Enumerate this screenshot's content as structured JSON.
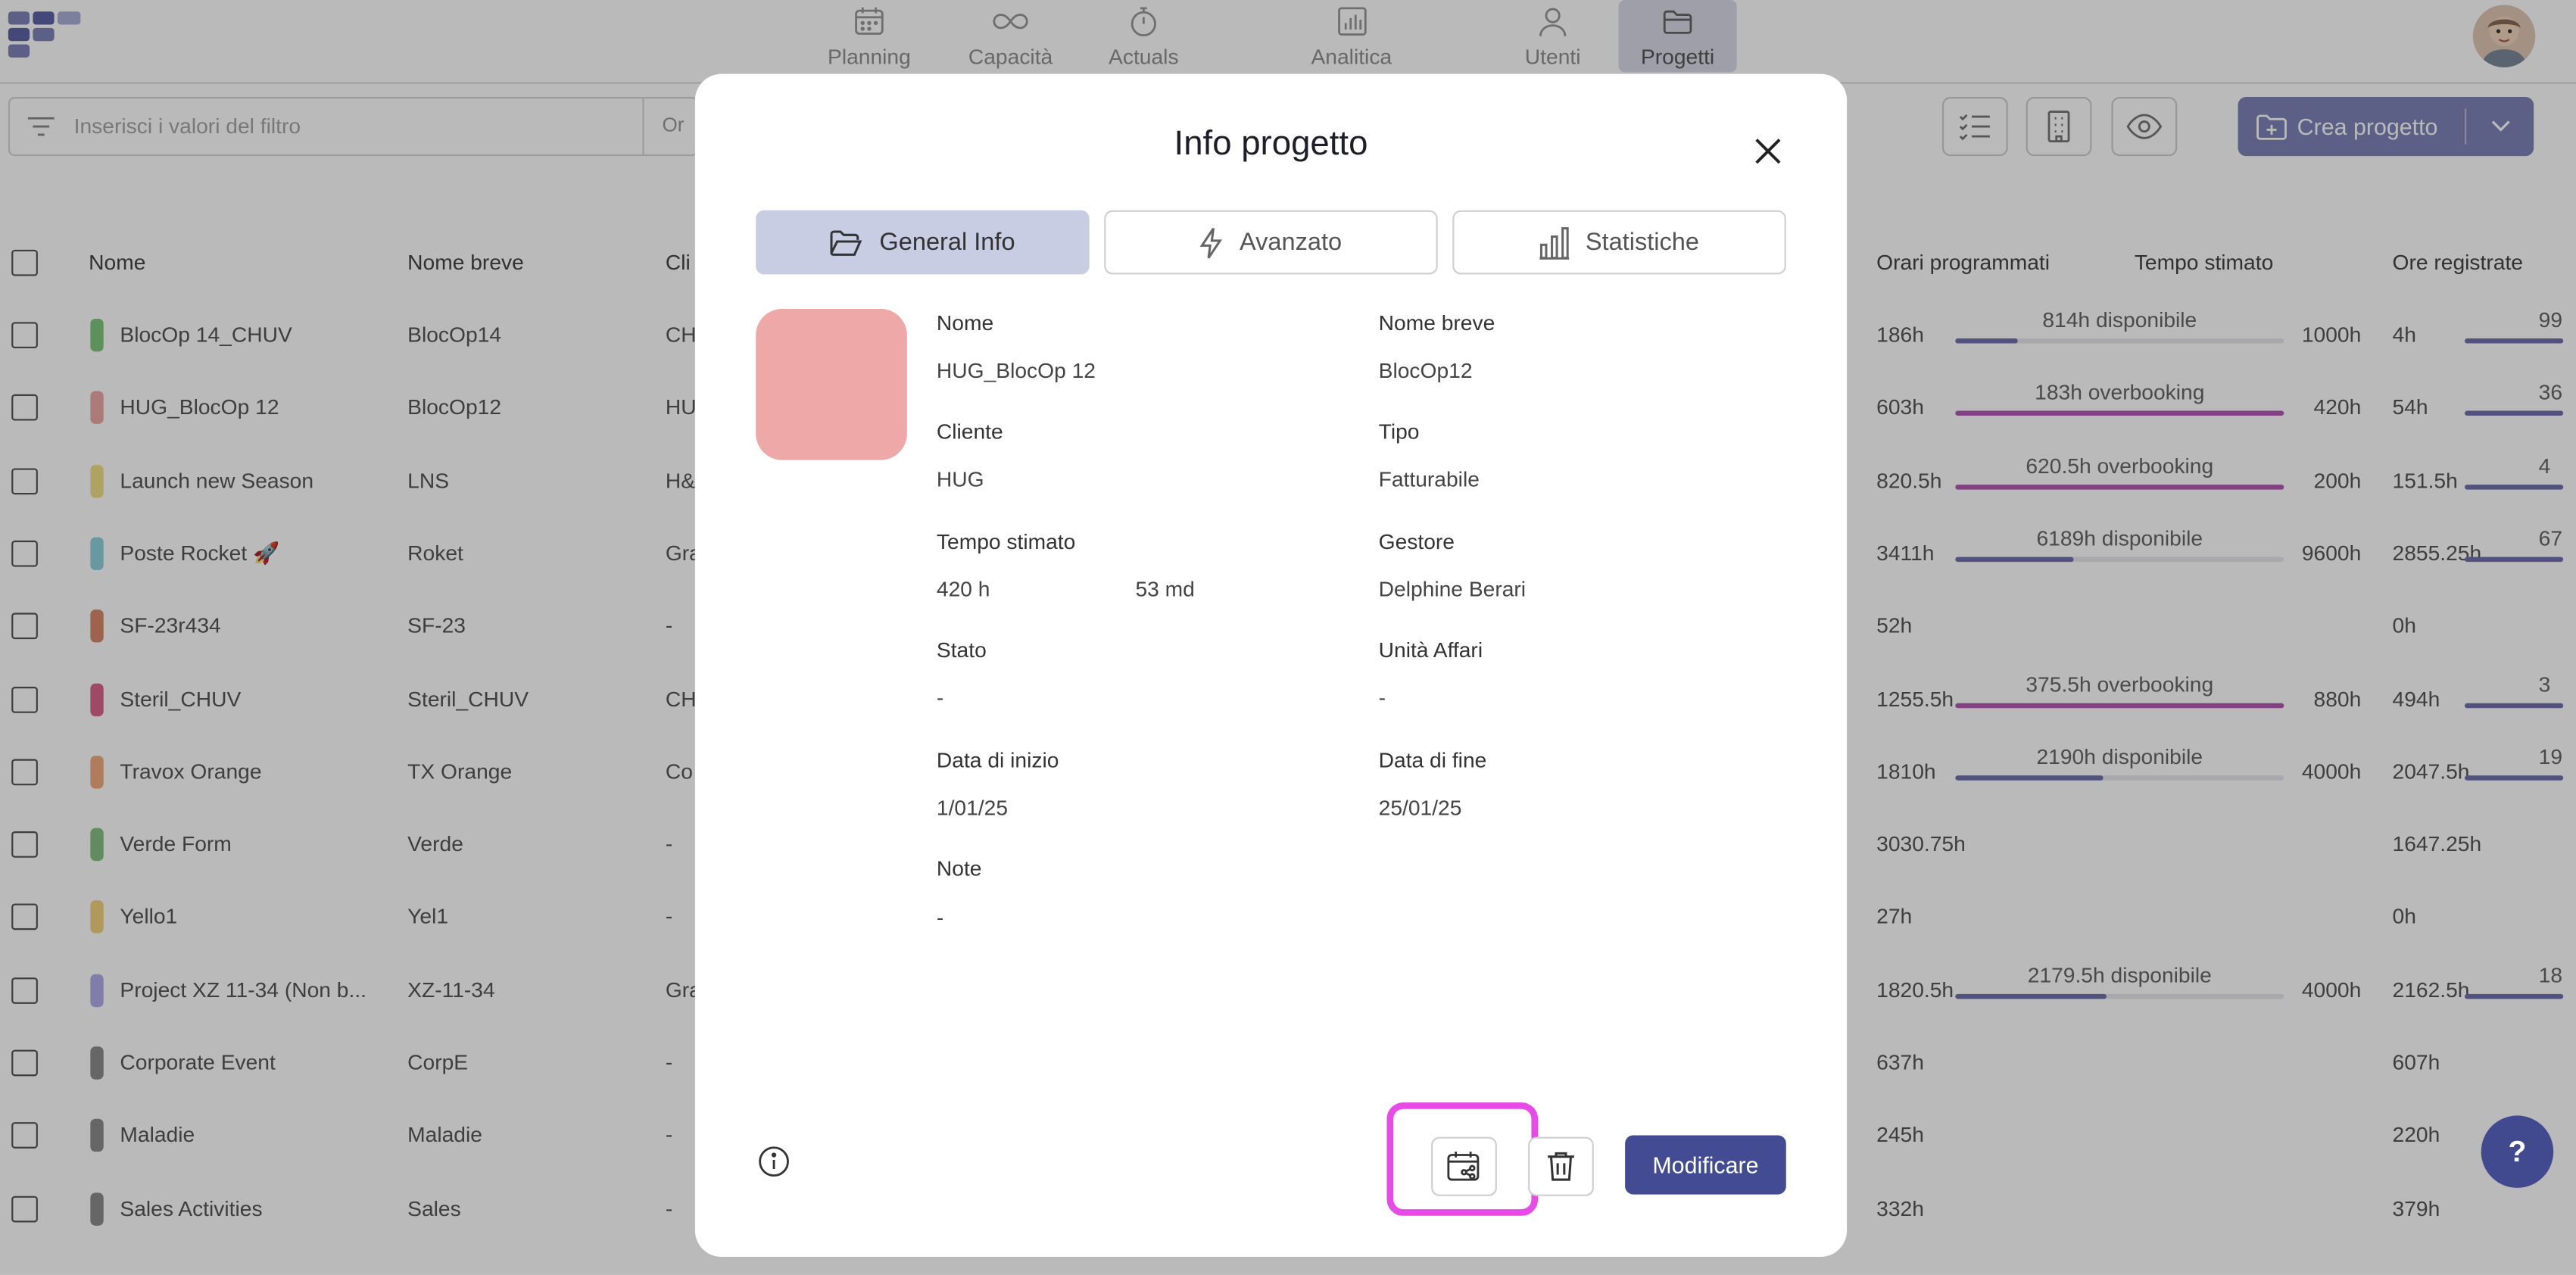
{
  "nav": {
    "items": [
      {
        "label": "Planning",
        "icon": "calendar-icon"
      },
      {
        "label": "Capacità",
        "icon": "infinity-icon"
      },
      {
        "label": "Actuals",
        "icon": "stopwatch-icon"
      },
      {
        "label": "Analitica",
        "icon": "bar-chart-icon"
      },
      {
        "label": "Utenti",
        "icon": "user-icon"
      },
      {
        "label": "Progetti",
        "icon": "folder-icon",
        "active": true
      }
    ]
  },
  "toolbar": {
    "filter_placeholder": "Inserisci i valori del filtro",
    "filter_or": "Or",
    "create_label": "Crea progetto"
  },
  "table": {
    "columns": {
      "name": "Nome",
      "short": "Nome breve",
      "client": "Cli",
      "scheduled": "Orari programmati",
      "estimated": "Tempo stimato",
      "logged": "Ore registrate"
    },
    "rows": [
      {
        "color": "#7fc97a",
        "name": "BlocOp 14_CHUV",
        "short": "BlocOp14",
        "client": "CH",
        "scheduled": "186h",
        "bar_label": "814h disponibile",
        "bar_fill": 0.19,
        "overbooking": false,
        "estimated": "1000h",
        "logged": "4h",
        "logged_cut": "99"
      },
      {
        "color": "#eea8a8",
        "name": "HUG_BlocOp 12",
        "short": "BlocOp12",
        "client": "HU",
        "scheduled": "603h",
        "bar_label": "183h overbooking",
        "bar_fill": 1,
        "overbooking": true,
        "estimated": "420h",
        "logged": "54h",
        "logged_cut": "36"
      },
      {
        "color": "#f0e08a",
        "name": "Launch new Season",
        "short": "LNS",
        "client": "H&",
        "scheduled": "820.5h",
        "bar_label": "620.5h overbooking",
        "bar_fill": 1,
        "overbooking": true,
        "estimated": "200h",
        "logged": "151.5h",
        "logged_cut": "4"
      },
      {
        "color": "#8fd1dc",
        "name": "Poste Rocket 🚀",
        "short": "Roket",
        "client": "Gra",
        "scheduled": "3411h",
        "bar_label": "6189h disponibile",
        "bar_fill": 0.36,
        "overbooking": false,
        "estimated": "9600h",
        "logged": "2855.25h",
        "logged_cut": "67"
      },
      {
        "color": "#d88a6a",
        "name": "SF-23r434",
        "short": "SF-23",
        "client": "-",
        "scheduled": "52h",
        "bar_label": "",
        "bar_fill": 0,
        "overbooking": false,
        "estimated": "",
        "logged": "0h",
        "logged_cut": ""
      },
      {
        "color": "#d9668e",
        "name": "Steril_CHUV",
        "short": "Steril_CHUV",
        "client": "CH",
        "scheduled": "1255.5h",
        "bar_label": "375.5h overbooking",
        "bar_fill": 1,
        "overbooking": true,
        "estimated": "880h",
        "logged": "494h",
        "logged_cut": "3"
      },
      {
        "color": "#f0ab7e",
        "name": "Travox Orange",
        "short": "TX Orange",
        "client": "Co",
        "scheduled": "1810h",
        "bar_label": "2190h disponibile",
        "bar_fill": 0.45,
        "overbooking": false,
        "estimated": "4000h",
        "logged": "2047.5h",
        "logged_cut": "19"
      },
      {
        "color": "#86c084",
        "name": "Verde Form",
        "short": "Verde",
        "client": "-",
        "scheduled": "3030.75h",
        "bar_label": "",
        "bar_fill": 0,
        "overbooking": false,
        "estimated": "",
        "logged": "1647.25h",
        "logged_cut": ""
      },
      {
        "color": "#f1d27c",
        "name": "Yello1",
        "short": "Yel1",
        "client": "-",
        "scheduled": "27h",
        "bar_label": "",
        "bar_fill": 0,
        "overbooking": false,
        "estimated": "",
        "logged": "0h",
        "logged_cut": ""
      },
      {
        "color": "#b1acea",
        "name": "Project XZ 11-34 (Non b...",
        "short": "XZ-11-34",
        "client": "Gra",
        "scheduled": "1820.5h",
        "bar_label": "2179.5h disponibile",
        "bar_fill": 0.46,
        "overbooking": false,
        "estimated": "4000h",
        "logged": "2162.5h",
        "logged_cut": "18"
      },
      {
        "color": "#8c8c8c",
        "name": "Corporate Event",
        "short": "CorpE",
        "client": "-",
        "scheduled": "637h",
        "bar_label": "",
        "bar_fill": 0,
        "overbooking": false,
        "estimated": "",
        "logged": "607h",
        "logged_cut": ""
      },
      {
        "color": "#8c8c8c",
        "name": "Maladie",
        "short": "Maladie",
        "client": "-",
        "scheduled": "245h",
        "bar_label": "",
        "bar_fill": 0,
        "overbooking": false,
        "estimated": "",
        "logged": "220h",
        "logged_cut": ""
      },
      {
        "color": "#8c8c8c",
        "name": "Sales Activities",
        "short": "Sales",
        "client": "-",
        "scheduled": "332h",
        "bar_label": "",
        "bar_fill": 0,
        "overbooking": false,
        "estimated": "",
        "logged": "379h",
        "logged_cut": ""
      }
    ]
  },
  "help": {
    "label": "?"
  },
  "modal": {
    "title": "Info progetto",
    "tabs": [
      {
        "label": "General Info",
        "icon": "folder-open-icon",
        "active": true
      },
      {
        "label": "Avanzato",
        "icon": "lightning-icon"
      },
      {
        "label": "Statistiche",
        "icon": "bar-chart-icon"
      }
    ],
    "project_color": "#eea8a8",
    "fields": {
      "name_label": "Nome",
      "name_value": "HUG_BlocOp 12",
      "short_label": "Nome breve",
      "short_value": "BlocOp12",
      "client_label": "Cliente",
      "client_value": "HUG",
      "type_label": "Tipo",
      "type_value": "Fatturabile",
      "estimate_label": "Tempo stimato",
      "estimate_hours": "420 h",
      "estimate_days": "53 md",
      "manager_label": "Gestore",
      "manager_value": "Delphine Berari",
      "status_label": "Stato",
      "status_value": "-",
      "bu_label": "Unità Affari",
      "bu_value": "-",
      "start_label": "Data di inizio",
      "start_value": "1/01/25",
      "end_label": "Data di fine",
      "end_value": "25/01/25",
      "notes_label": "Note",
      "notes_value": "-"
    },
    "edit_label": "Modificare"
  }
}
